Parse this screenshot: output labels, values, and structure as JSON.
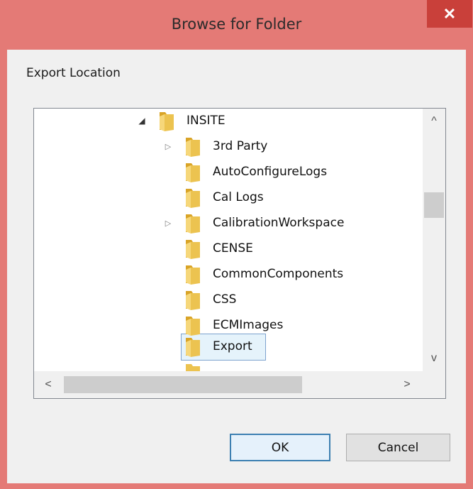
{
  "window": {
    "title": "Browse for Folder",
    "close_label": "✕"
  },
  "dialog": {
    "description": "Export Location"
  },
  "tree": {
    "items": [
      {
        "label": "INSITE",
        "expander": "◢"
      },
      {
        "label": "3rd Party",
        "expander": "▷"
      },
      {
        "label": "AutoConfigureLogs",
        "expander": ""
      },
      {
        "label": "Cal Logs",
        "expander": ""
      },
      {
        "label": "CalibrationWorkspace",
        "expander": "▷"
      },
      {
        "label": "CENSE",
        "expander": ""
      },
      {
        "label": "CommonComponents",
        "expander": ""
      },
      {
        "label": "CSS",
        "expander": ""
      },
      {
        "label": "ECMImages",
        "expander": ""
      },
      {
        "label": "Export",
        "expander": ""
      }
    ],
    "selected": "Export"
  },
  "scrollbars": {
    "up": "^",
    "down": "v",
    "left": "<",
    "right": ">"
  },
  "buttons": {
    "ok": "OK",
    "cancel": "Cancel"
  },
  "colors": {
    "frame": "#e47a76",
    "close": "#c9403a",
    "selection": "#e5f3fb",
    "selection_border": "#7da2ce"
  }
}
